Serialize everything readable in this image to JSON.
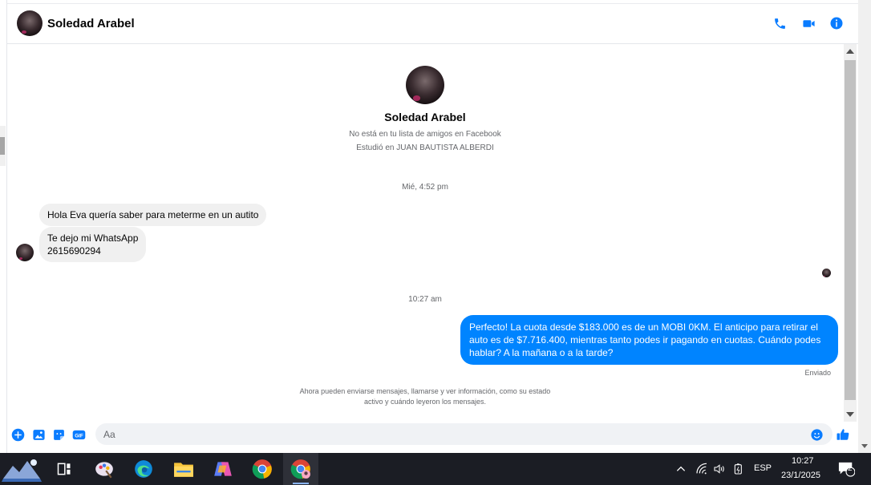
{
  "chat": {
    "contact_name": "Soledad Arabel",
    "header_icons": [
      "phone-icon",
      "video-icon",
      "info-icon"
    ],
    "accent_color": "#0084ff"
  },
  "profile": {
    "name": "Soledad Arabel",
    "subtitle_1": "No está en tu lista de amigos en Facebook",
    "subtitle_2": "Estudió en JUAN BAUTISTA ALBERDI"
  },
  "messages": {
    "timestamp_1": "Mié, 4:52 pm",
    "in_1": "Hola Eva quería saber para meterme en un autito",
    "in_2_line1": "Te dejo mi WhatsApp",
    "in_2_line2": "2615690294",
    "timestamp_2": "10:27 am",
    "out_1": "Perfecto! La cuota desde $183.000 es de un MOBI 0KM. El anticipo para retirar el auto es de $7.716.400, mientras tanto podes ir pagando en cuotas. Cuándo podes hablar? A la mañana o a la tarde?",
    "status": "Enviado",
    "notice_line1": "Ahora pueden enviarse mensajes, llamarse y ver información, como su estado",
    "notice_line2": "activo y cuándo leyeron los mensajes."
  },
  "composer": {
    "placeholder": "Aa",
    "icons": [
      "plus-icon",
      "image-icon",
      "sticker-icon",
      "gif-icon",
      "emoji-icon",
      "like-icon"
    ],
    "gif_label": "GIF"
  },
  "taskbar": {
    "apps": [
      "start-button",
      "task-view",
      "paint-app",
      "edge-app",
      "file-explorer",
      "copilot-app",
      "chrome-app",
      "chrome-profile-app"
    ],
    "language": "ESP",
    "time": "10:27",
    "date": "23/1/2025",
    "notification_count": "2"
  }
}
